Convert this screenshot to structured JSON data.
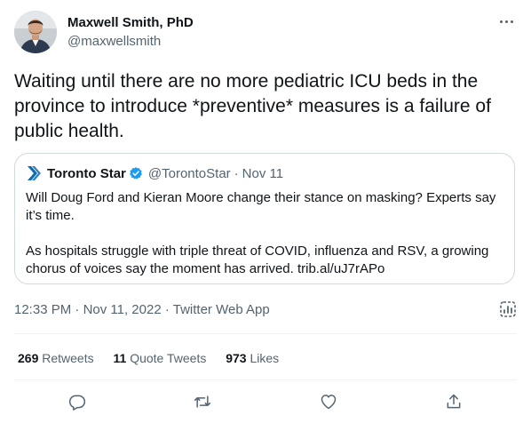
{
  "author": {
    "name": "Maxwell Smith, PhD",
    "handle": "@maxwellsmith"
  },
  "tweet": {
    "text": "Waiting until there are no more pediatric ICU beds in the province to introduce *preventive* measures is a failure of public health."
  },
  "quoted": {
    "name": "Toronto Star",
    "handle": "@TorontoStar",
    "separator": "·",
    "date": "Nov 11",
    "paragraph1": "Will Doug Ford and Kieran Moore change their stance on masking? Experts say it’s time.",
    "paragraph2": "As hospitals struggle with triple threat of COVID, influenza and RSV, a growing chorus of voices say the moment has arrived. trib.al/uJ7rAPo"
  },
  "meta": {
    "time": "12:33 PM",
    "separator1": " · ",
    "date": "Nov 11, 2022",
    "separator2": " · ",
    "source": "Twitter Web App"
  },
  "stats": {
    "retweets_count": "269",
    "retweets_label": "Retweets",
    "quotes_count": "11",
    "quotes_label": "Quote Tweets",
    "likes_count": "973",
    "likes_label": "Likes"
  },
  "icons": {
    "more": "more-horizontal-icon",
    "brand": "toronto-star-logo",
    "verified": "verified-badge-icon",
    "analytics": "analytics-icon",
    "reply": "reply-icon",
    "retweet": "retweet-icon",
    "like": "heart-icon",
    "share": "share-icon"
  },
  "colors": {
    "text": "#0f1419",
    "secondary": "#536471",
    "border": "#cfd9de",
    "verified": "#1d9bf0",
    "brand": "#0a6ab5"
  }
}
